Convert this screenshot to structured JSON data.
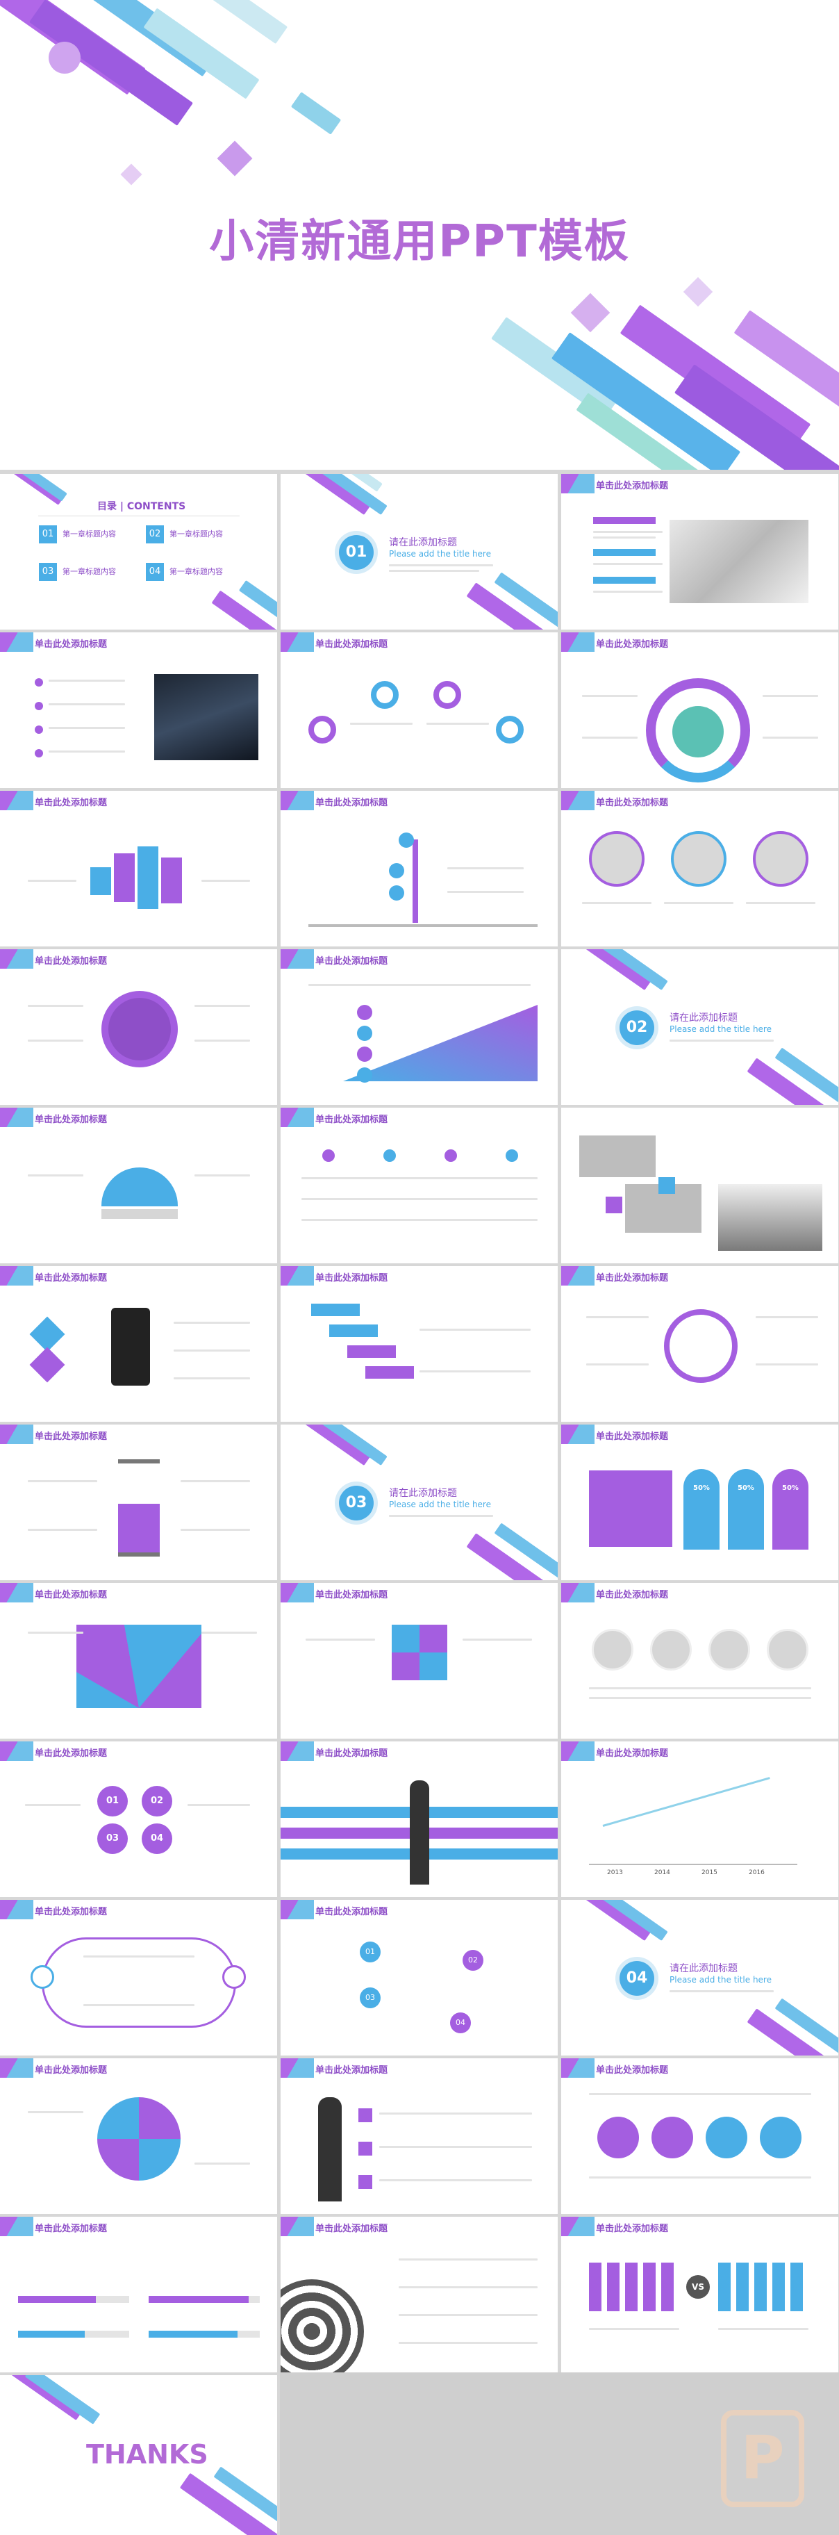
{
  "cover": {
    "title": "小清新通用PPT模板"
  },
  "common": {
    "slide_title": "单击此处添加标题"
  },
  "toc": {
    "heading": "目录 | CONTENTS",
    "items": [
      {
        "num": "01",
        "label": "第一章标题内容"
      },
      {
        "num": "02",
        "label": "第一章标题内容"
      },
      {
        "num": "03",
        "label": "第一章标题内容"
      },
      {
        "num": "04",
        "label": "第一章标题内容"
      }
    ]
  },
  "sections": [
    {
      "num": "01",
      "cn": "请在此添加标题",
      "en": "Please add the title here"
    },
    {
      "num": "02",
      "cn": "请在此添加标题",
      "en": "Please add the title here"
    },
    {
      "num": "03",
      "cn": "请在此添加标题",
      "en": "Please add the title here"
    },
    {
      "num": "04",
      "cn": "请在此添加标题",
      "en": "Please add the title here"
    }
  ],
  "percent_cards": [
    "50%",
    "50%",
    "50%"
  ],
  "timeline_years": [
    "2013",
    "2014",
    "2015",
    "2016"
  ],
  "versus": "VS",
  "hex_labels": [
    "01",
    "02",
    "03",
    "04"
  ],
  "thanks": "THANKS",
  "logo_letter": "P",
  "colors": {
    "purple": "#a45ee0",
    "blue": "#4aaee6",
    "title_purple": "#8e4fc8",
    "cover_title": "#b26ad6"
  }
}
